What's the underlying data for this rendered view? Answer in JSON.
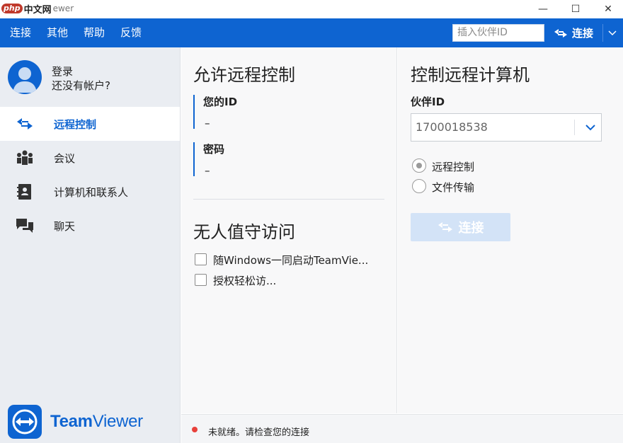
{
  "window": {
    "title_brand": "php",
    "title_site": "中文网",
    "title_tail": "ewer",
    "minimize_glyph": "—",
    "maximize_glyph": "☐",
    "close_glyph": "✕"
  },
  "menu": {
    "items": [
      "连接",
      "其他",
      "帮助",
      "反馈"
    ],
    "partner_placeholder": "插入伙伴ID",
    "connect_label": "连接"
  },
  "sidebar": {
    "login": "登录",
    "no_account": "还没有帐户?",
    "nav": [
      {
        "label": "远程控制",
        "icon": "arrows-swap-icon",
        "active": true
      },
      {
        "label": "会议",
        "icon": "people-icon",
        "active": false
      },
      {
        "label": "计算机和联系人",
        "icon": "contact-book-icon",
        "active": false
      },
      {
        "label": "聊天",
        "icon": "chat-icon",
        "active": false
      }
    ],
    "brand_bold": "Team",
    "brand_light": "Viewer"
  },
  "allow_remote": {
    "title": "允许远程控制",
    "your_id_label": "您的ID",
    "your_id_value": "–",
    "password_label": "密码",
    "password_value": "–"
  },
  "unattended": {
    "title": "无人值守访问",
    "options": [
      {
        "label": "随Windows一同启动TeamVie...",
        "checked": false
      },
      {
        "label": "授权轻松访...",
        "checked": false
      }
    ]
  },
  "control_remote": {
    "title": "控制远程计算机",
    "partner_id_label": "伙伴ID",
    "partner_id_value": "1700018538",
    "modes": [
      {
        "label": "远程控制",
        "checked": true
      },
      {
        "label": "文件传输",
        "checked": false
      }
    ],
    "connect_label": "连接"
  },
  "status": {
    "text": "未就绪。请检查您的连接",
    "color": "#e8413b"
  },
  "colors": {
    "accent": "#0e64d1",
    "disabled_button": "#d3e3f7"
  }
}
